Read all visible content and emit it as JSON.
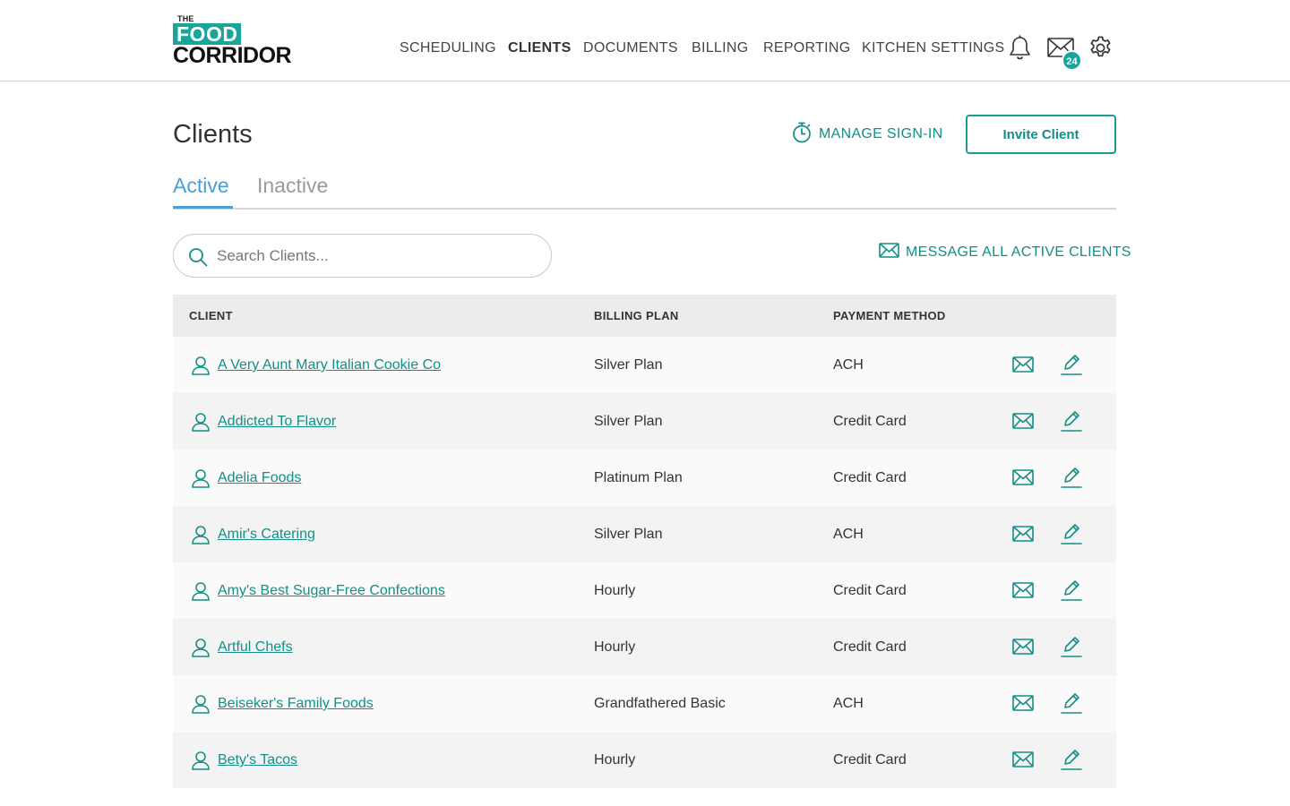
{
  "brand": {
    "the": "THE",
    "food": "FOOD",
    "corridor": "CORRIDOR",
    "accent": "#1aa59b"
  },
  "nav": [
    {
      "label": "SCHEDULING",
      "active": false
    },
    {
      "label": "CLIENTS",
      "active": true
    },
    {
      "label": "DOCUMENTS",
      "active": false
    },
    {
      "label": "BILLING",
      "active": false
    },
    {
      "label": "REPORTING",
      "active": false
    },
    {
      "label": "KITCHEN SETTINGS",
      "active": false
    }
  ],
  "header_icons": {
    "notifications": "bell-icon",
    "messages": "envelope-icon",
    "message_count": "24",
    "settings": "gear-icon"
  },
  "page": {
    "title": "Clients",
    "manage_signin": "MANAGE SIGN-IN",
    "invite_button": "Invite Client"
  },
  "tabs": [
    {
      "label": "Active",
      "active": true
    },
    {
      "label": "Inactive",
      "active": false
    }
  ],
  "search": {
    "placeholder": "Search Clients...",
    "value": ""
  },
  "message_all": "MESSAGE ALL ACTIVE CLIENTS",
  "table": {
    "columns": [
      "CLIENT",
      "BILLING PLAN",
      "PAYMENT METHOD"
    ],
    "rows": [
      {
        "client": "A Very Aunt Mary Italian Cookie Co",
        "plan": "Silver Plan",
        "payment": "ACH"
      },
      {
        "client": "Addicted To Flavor",
        "plan": "Silver Plan",
        "payment": "Credit Card"
      },
      {
        "client": "Adelia Foods",
        "plan": "Platinum Plan",
        "payment": "Credit Card"
      },
      {
        "client": "Amir's Catering",
        "plan": "Silver Plan",
        "payment": "ACH"
      },
      {
        "client": "Amy's Best Sugar-Free Confections",
        "plan": "Hourly",
        "payment": "Credit Card"
      },
      {
        "client": "Artful Chefs",
        "plan": "Hourly",
        "payment": "Credit Card"
      },
      {
        "client": "Beiseker's Family Foods",
        "plan": "Grandfathered Basic",
        "payment": "ACH"
      },
      {
        "client": "Bety's Tacos",
        "plan": "Hourly",
        "payment": "Credit Card"
      }
    ]
  }
}
